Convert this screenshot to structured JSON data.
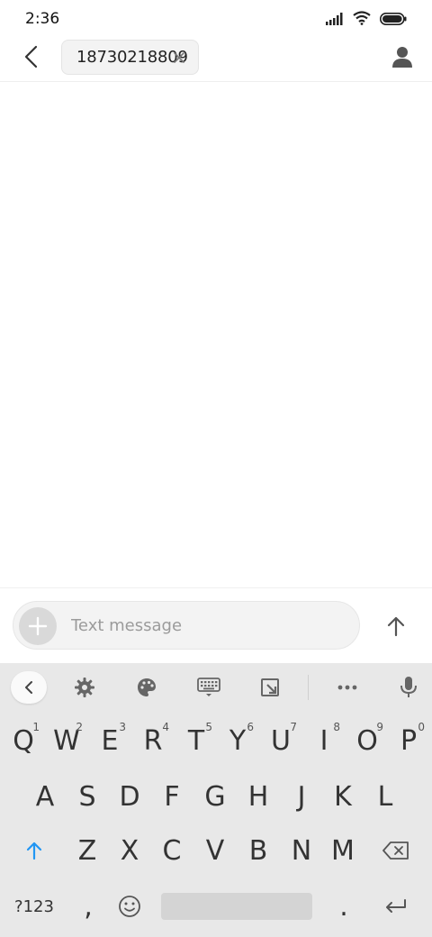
{
  "status_bar": {
    "time": "2:36",
    "icons": [
      "signal-icon",
      "wifi-icon",
      "battery-icon"
    ]
  },
  "header": {
    "recipient_chip": "18730218809",
    "icons": [
      "back-arrow-icon",
      "close-icon",
      "contact-icon"
    ]
  },
  "compose": {
    "placeholder": "Text message",
    "icons": [
      "plus-icon",
      "send-arrow-icon"
    ]
  },
  "keyboard": {
    "toolbar_icons": [
      "chevron-left-icon",
      "gear-icon",
      "palette-icon",
      "keyboard-icon",
      "resize-icon",
      "more-icon",
      "microphone-icon"
    ],
    "row1": [
      {
        "key": "Q",
        "hint": "1"
      },
      {
        "key": "W",
        "hint": "2"
      },
      {
        "key": "E",
        "hint": "3"
      },
      {
        "key": "R",
        "hint": "4"
      },
      {
        "key": "T",
        "hint": "5"
      },
      {
        "key": "Y",
        "hint": "6"
      },
      {
        "key": "U",
        "hint": "7"
      },
      {
        "key": "I",
        "hint": "8"
      },
      {
        "key": "O",
        "hint": "9"
      },
      {
        "key": "P",
        "hint": "0"
      }
    ],
    "row2": [
      "A",
      "S",
      "D",
      "F",
      "G",
      "H",
      "J",
      "K",
      "L"
    ],
    "row3": [
      "Z",
      "X",
      "C",
      "V",
      "B",
      "N",
      "M"
    ],
    "row4": {
      "symbols_label": "?123",
      "comma": ",",
      "period": "."
    },
    "accent_color": "#2196f3"
  }
}
